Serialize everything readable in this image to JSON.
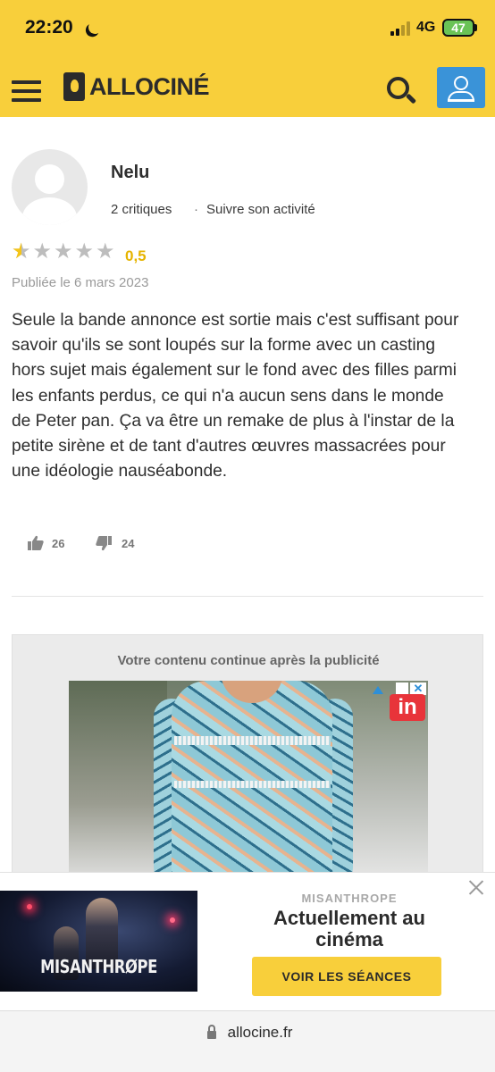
{
  "status_bar": {
    "time": "22:20",
    "network": "4G",
    "battery": "47"
  },
  "header": {
    "logo_text": "ALLOCINÉ",
    "menu_icon": "hamburger-menu-icon",
    "search_icon": "search-icon",
    "account_icon": "user-icon",
    "background_color": "#f8cf3b",
    "account_button_color": "#3a93d8"
  },
  "review": {
    "username": "Nelu",
    "critiques": "2 critiques",
    "separator": "·",
    "follow_label": "Suivre son activité",
    "rating": "0,5",
    "rating_value": 0.5,
    "rating_max": 5,
    "published": "Publiée le 6 mars 2023",
    "text": "Seule la bande annonce est sortie mais c'est suffisant pour savoir qu'ils se sont loupés sur la forme avec un casting hors sujet mais également sur le fond avec des filles parmi les enfants perdus, ce qui n'a aucun sens dans le monde de Peter pan. Ça va être un remake de plus à l'instar de la petite sirène et de tant d'autres œuvres massacrées pour une idéologie nauséabonde.",
    "likes": "26",
    "dislikes": "24"
  },
  "ad": {
    "notice": "Votre contenu continue après la publicité",
    "brand_badge": "in",
    "close_glyph": "✕"
  },
  "banner": {
    "poster_title": "MISANTHRØPE",
    "film": "MISANTHROPE",
    "headline": "Actuellement au cinéma",
    "cta": "VOIR LES SÉANCES",
    "cta_color": "#f8cf3b"
  },
  "browser": {
    "url": "allocine.fr"
  }
}
